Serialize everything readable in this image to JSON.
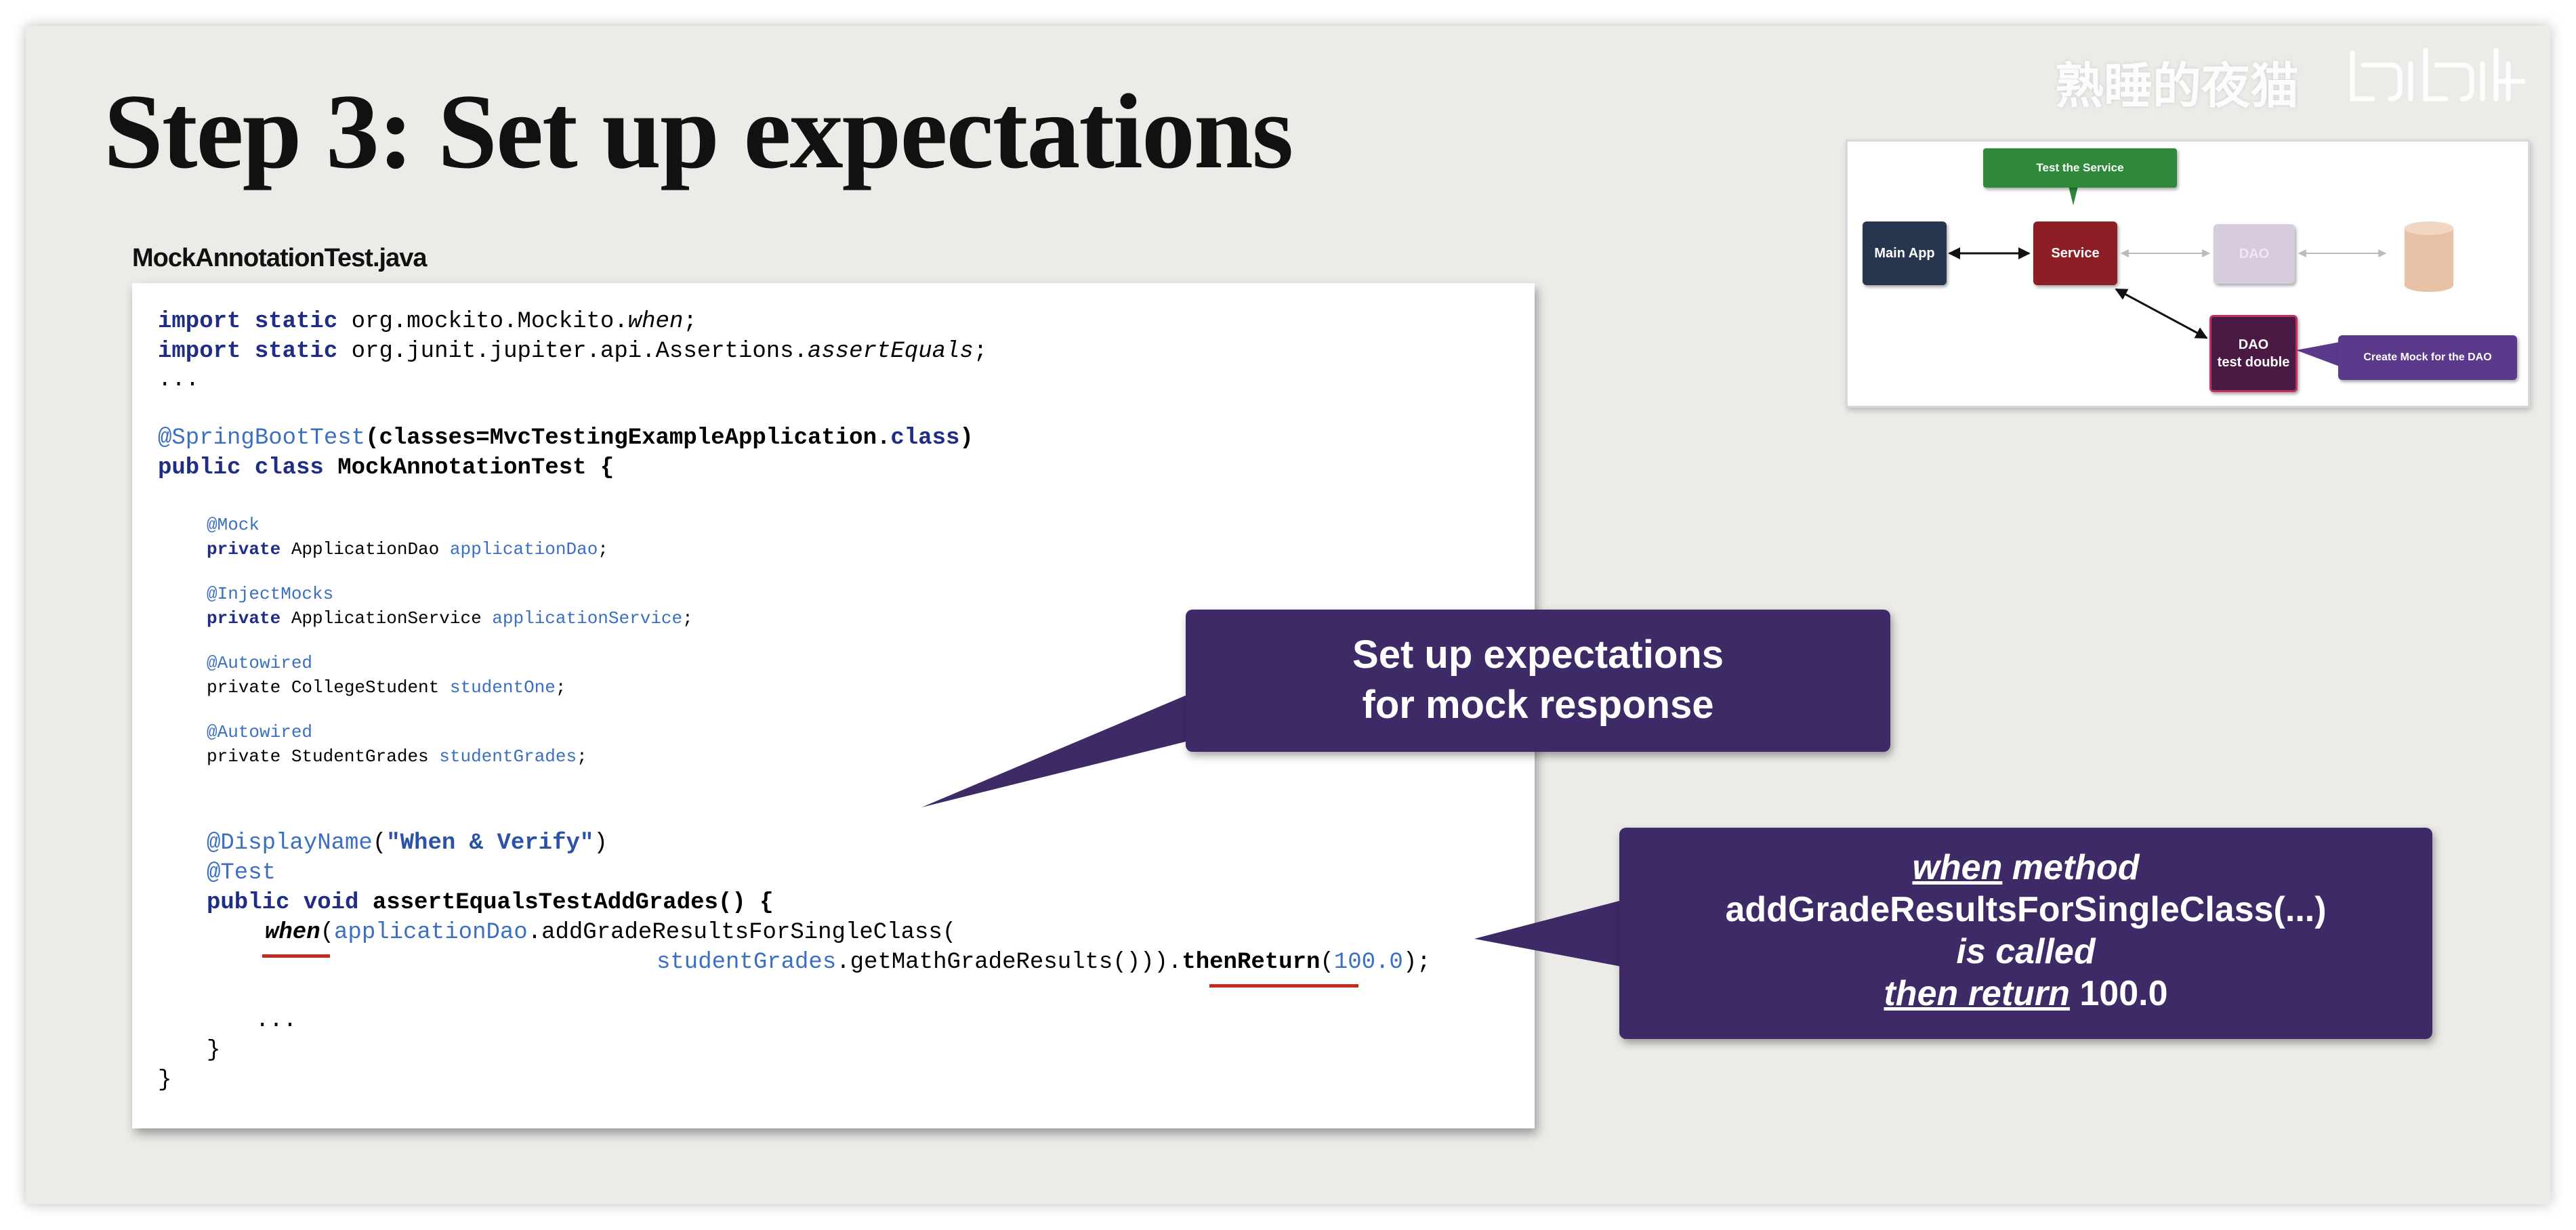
{
  "slide": {
    "title": "Step 3: Set up expectations",
    "file_name": "MockAnnotationTest.java",
    "watermark": "熟睡的夜猫",
    "watermark_logo": "bilibili"
  },
  "code": {
    "l1_kw": "import static",
    "l1_rest": " org.mockito.Mockito.",
    "l1_it": "when",
    "l1_end": ";",
    "l2_kw": "import static",
    "l2_rest": " org.junit.jupiter.api.Assertions.",
    "l2_it": "assertEquals",
    "l2_end": ";",
    "l3": "...",
    "l4_ann": "@SpringBootTest",
    "l4_a": "(classes=MvcTestingExampleApplication.",
    "l4_kw": "class",
    "l4_b": ")",
    "l5_kw": "public class",
    "l5_rest": " MockAnnotationTest {",
    "mock_ann": "@Mock",
    "mock_kw": "private",
    "mock_type": " ApplicationDao ",
    "mock_fld": "applicationDao",
    "mock_end": ";",
    "inj_ann": "@InjectMocks",
    "inj_kw": "private",
    "inj_type": " ApplicationService ",
    "inj_fld": "applicationService",
    "inj_end": ";",
    "aw1_ann": "@Autowired",
    "aw1_kw": "private",
    "aw1_type": " CollegeStudent ",
    "aw1_fld": "studentOne",
    "aw1_end": ";",
    "aw2_ann": "@Autowired",
    "aw2_kw": "private",
    "aw2_type": " StudentGrades ",
    "aw2_fld": "studentGrades",
    "aw2_end": ";",
    "dn_ann": "@DisplayName",
    "dn_a": "(",
    "dn_str": "\"When & Verify\"",
    "dn_b": ")",
    "test_ann": "@Test",
    "m_kw": "public void",
    "m_rest": " assertEqualsTestAddGrades() {",
    "w_call": "when",
    "w_a": "(",
    "w_fld": "applicationDao",
    "w_b": ".addGradeResultsForSingleClass(",
    "w2_fld": "studentGrades",
    "w2_a": ".getMathGradeResults())).",
    "w2_then": "thenReturn",
    "w2_b": "(",
    "w2_num": "100.0",
    "w2_c": ");",
    "dots": "...",
    "close1": "}",
    "close2": "}"
  },
  "callouts": {
    "c1_line1": "Set up expectations",
    "c1_line2": "for mock response",
    "c2_when": "when",
    "c2_method": " method",
    "c2_line2": "addGradeResultsForSingleClass(...)",
    "c2_line3": "is called",
    "c2_then": "then return",
    "c2_value": " 100.0"
  },
  "diagram": {
    "test_label": "Test the Service",
    "main_app": "Main App",
    "service": "Service",
    "dao": "DAO",
    "dao_td_1": "DAO",
    "dao_td_2": "test double",
    "mock_label": "Create Mock for the DAO"
  },
  "colors": {
    "callout": "#3e2a66",
    "keyword": "#1f2d86",
    "annotation": "#3b6fc2",
    "underline": "#c62a1f",
    "service": "#8e1e25",
    "main_app": "#28354f",
    "test_label": "#2e8a3a"
  }
}
